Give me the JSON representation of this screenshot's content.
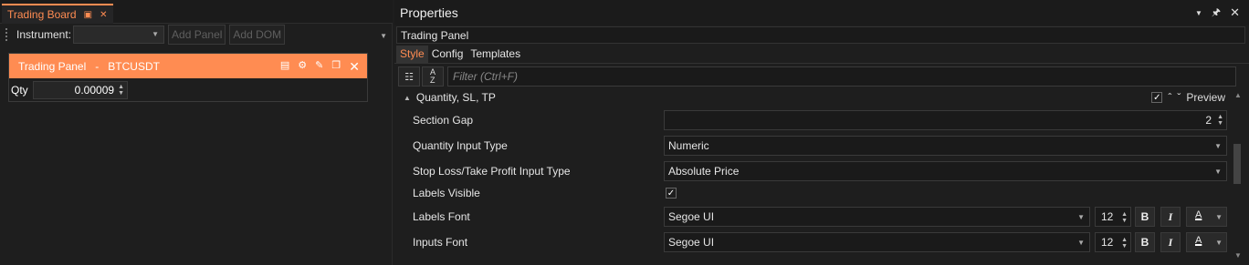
{
  "board": {
    "tab_title": "Trading Board",
    "toolbar": {
      "instrument_label": "Instrument:",
      "instrument_value": "",
      "add_panel_label": "Add Panel",
      "add_dom_label": "Add DOM"
    },
    "panel": {
      "title": "Trading Panel",
      "separator": "-",
      "symbol": "BTCUSDT",
      "qty_label": "Qty",
      "qty_value": "0.00009"
    }
  },
  "properties": {
    "title": "Properties",
    "object_name": "Trading Panel",
    "tabs": [
      {
        "label": "Style",
        "active": true
      },
      {
        "label": "Config",
        "active": false
      },
      {
        "label": "Templates",
        "active": false
      }
    ],
    "filter_placeholder": "Filter (Ctrl+F)",
    "section": {
      "title": "Quantity, SL, TP",
      "preview_label": "Preview"
    },
    "rows": [
      {
        "name": "Section Gap",
        "value": "2"
      },
      {
        "name": "Quantity Input Type",
        "value": "Numeric"
      },
      {
        "name": "Stop Loss/Take Profit Input Type",
        "value": "Absolute Price"
      },
      {
        "name": "Labels Visible",
        "checked": true
      },
      {
        "name": "Labels Font",
        "font": "Segoe UI",
        "size": "12",
        "bold": "B",
        "italic": "I",
        "color_glyph": "A"
      },
      {
        "name": "Inputs Font",
        "font": "Segoe UI",
        "size": "12",
        "bold": "B",
        "italic": "I",
        "color_glyph": "A"
      }
    ]
  },
  "colors": {
    "accent": "#ff8c52",
    "background": "#1e1e1e"
  }
}
